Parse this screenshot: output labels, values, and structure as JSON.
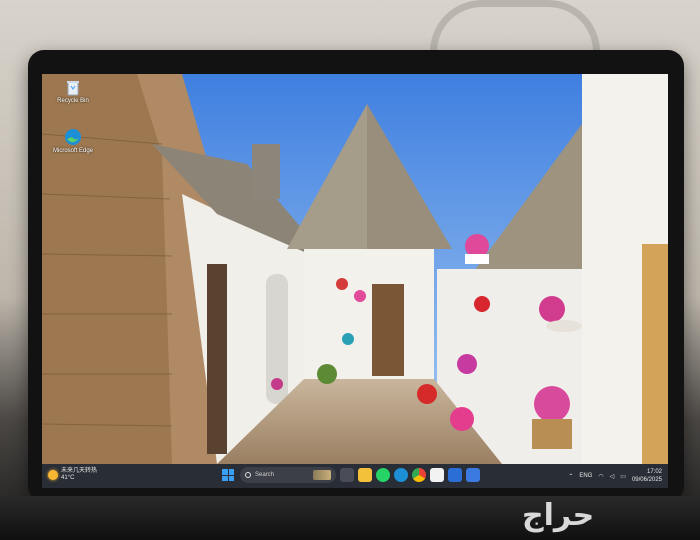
{
  "desktop": {
    "icons": [
      {
        "label": "Recycle Bin",
        "icon": "recycle-bin-icon"
      },
      {
        "label": "Microsoft Edge",
        "icon": "edge-icon"
      }
    ],
    "top_right_text": "",
    "wallpaper": "trulli-houses-alley"
  },
  "taskbar": {
    "weather": {
      "line1": "未来几天转热",
      "line2": "41°C",
      "icon": "sun-icon"
    },
    "search_placeholder": "Search",
    "pinned_icons": [
      "start-icon",
      "search-icon",
      "task-view-icon",
      "file-explorer-icon",
      "whatsapp-icon",
      "edge-icon",
      "chrome-icon",
      "store-icon",
      "mail-icon",
      "app-icon"
    ],
    "tray": {
      "language": "ENG",
      "time": "17:02",
      "date": "09/06/2025"
    }
  },
  "watermark": "حراج",
  "colors": {
    "sky": "#6aa4e4",
    "taskbar": "#26282e",
    "accent": "#3aa0f3"
  }
}
